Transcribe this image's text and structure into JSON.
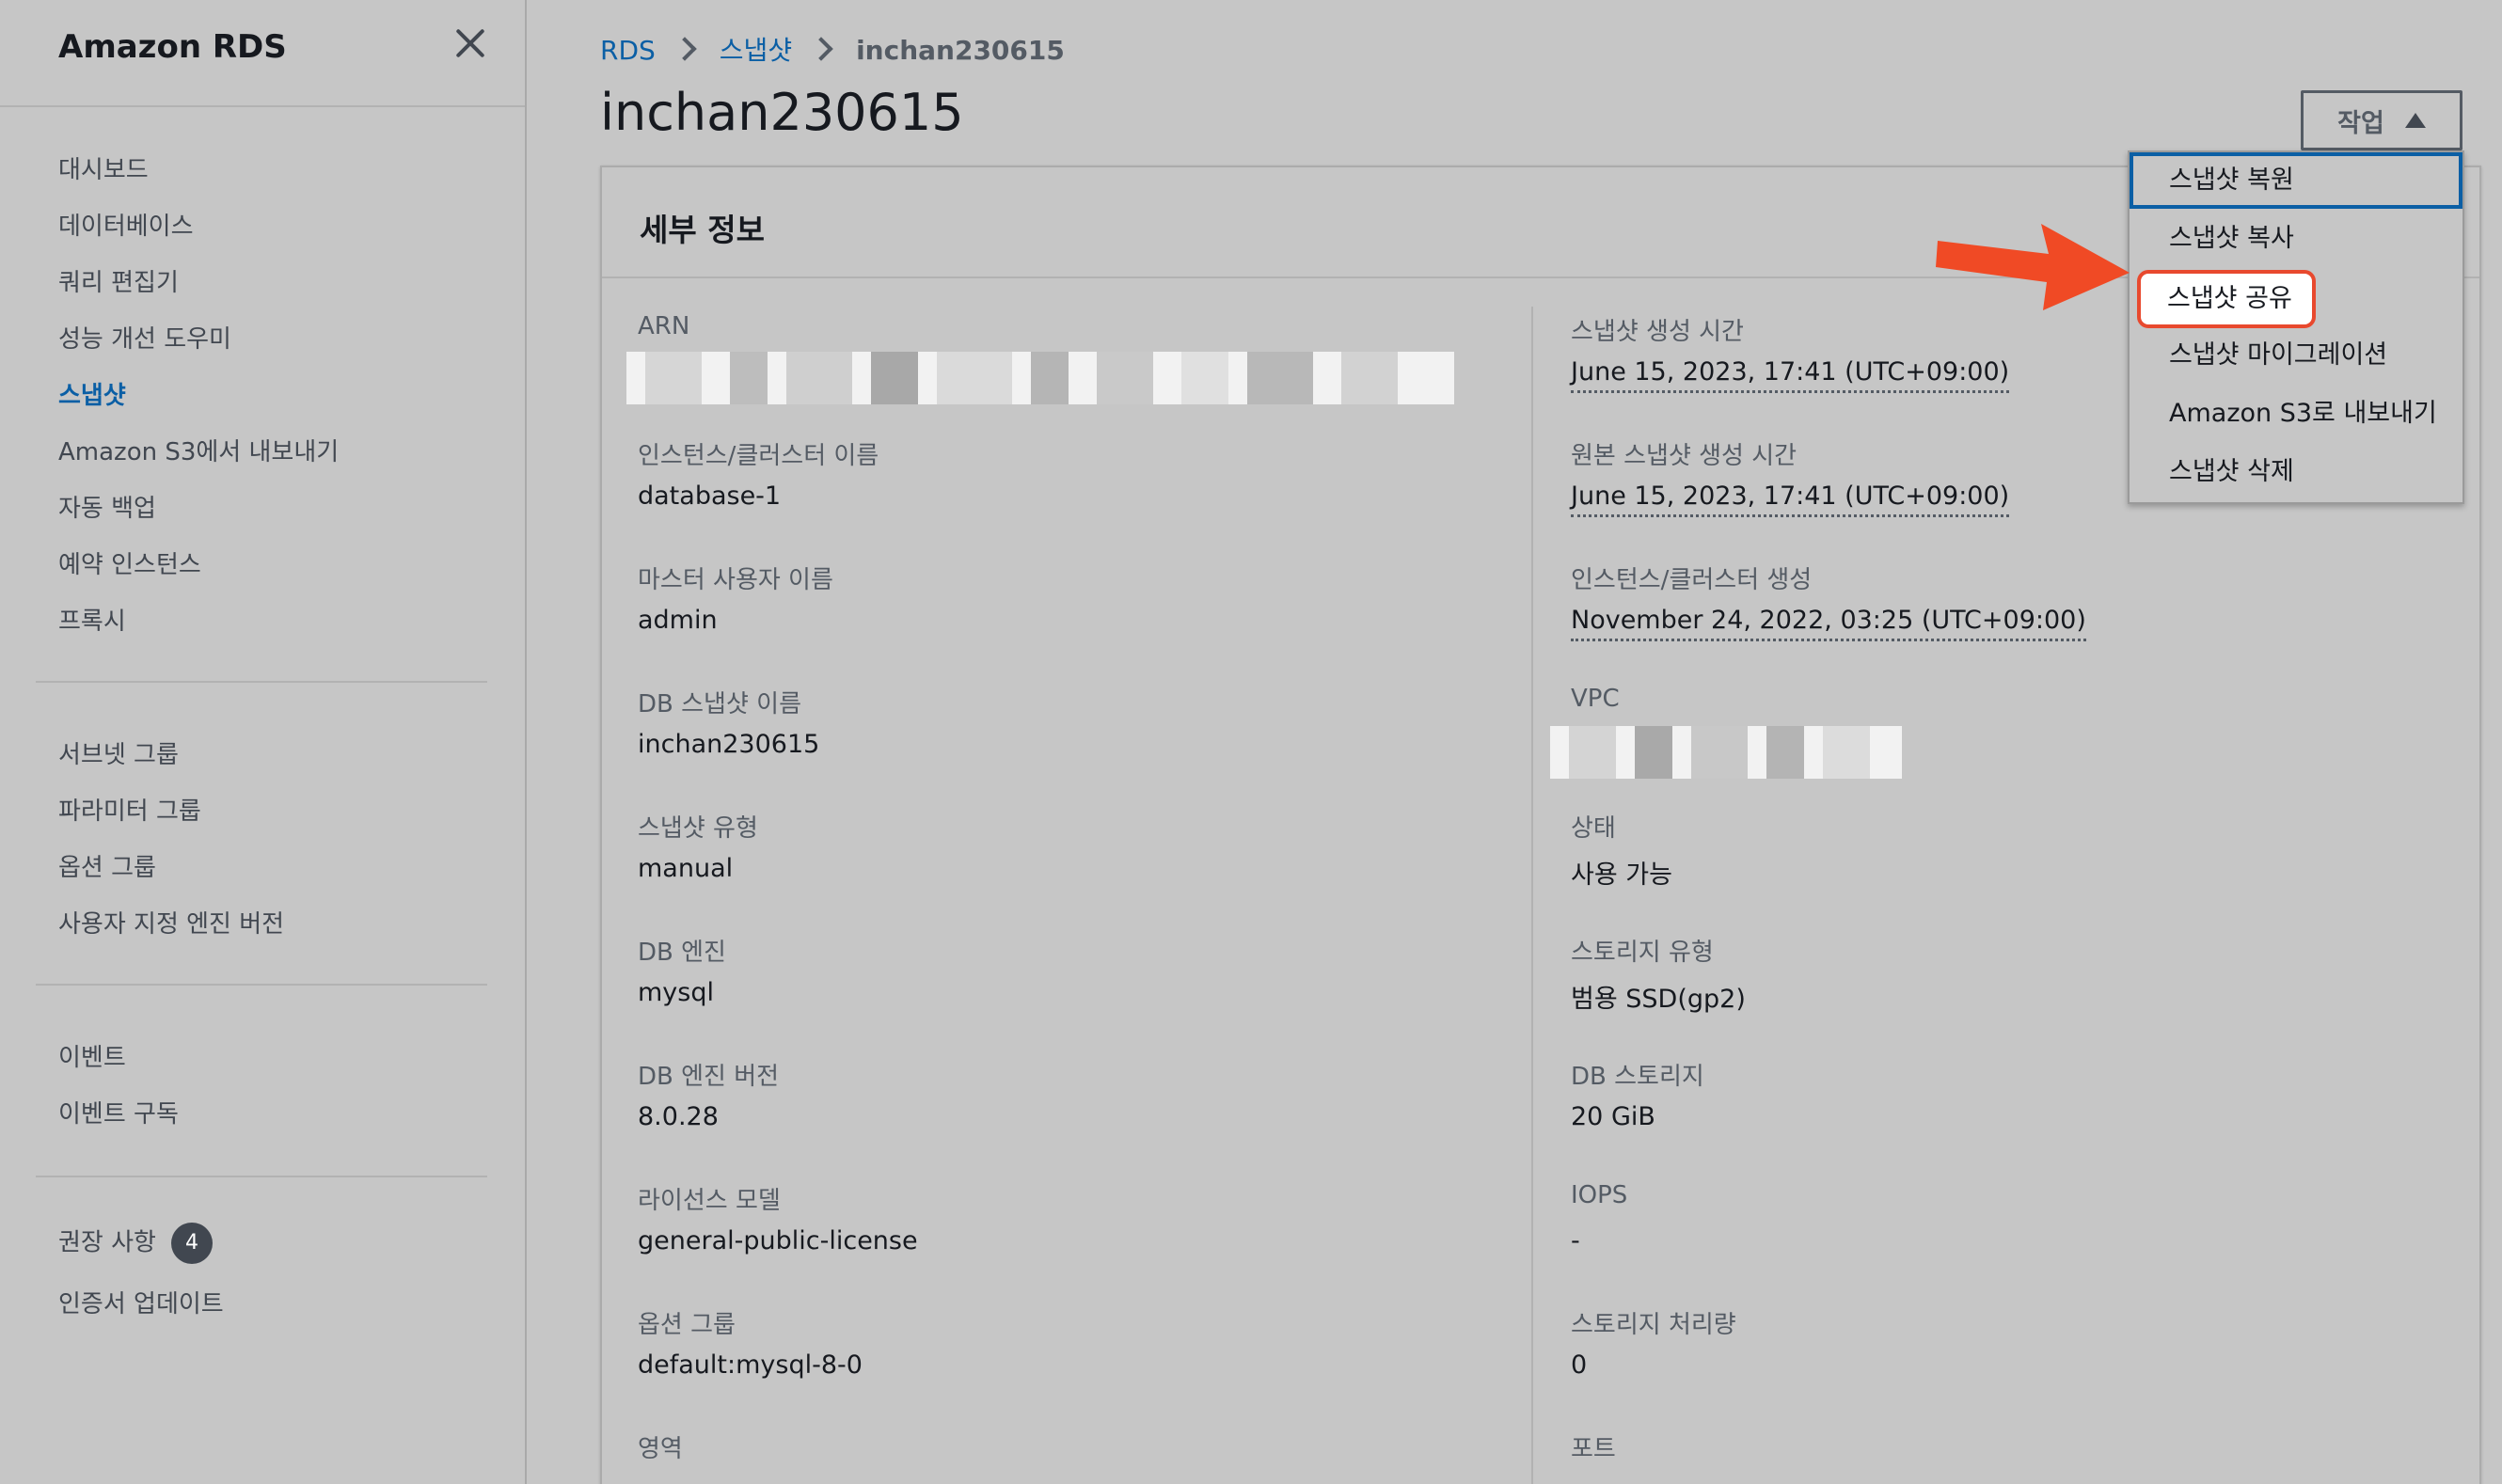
{
  "sidebar": {
    "title": "Amazon RDS",
    "groups": [
      [
        "대시보드",
        "데이터베이스",
        "쿼리 편집기",
        "성능 개선 도우미",
        "스냅샷",
        "Amazon S3에서 내보내기",
        "자동 백업",
        "예약 인스턴스",
        "프록시"
      ],
      [
        "서브넷 그룹",
        "파라미터 그룹",
        "옵션 그룹",
        "사용자 지정 엔진 버전"
      ],
      [
        "이벤트",
        "이벤트 구독"
      ],
      [
        "권장 사항",
        "인증서 업데이트"
      ]
    ],
    "active_item": "스냅샷",
    "recommendations_badge": "4"
  },
  "breadcrumb": {
    "root": "RDS",
    "section": "스냅샷",
    "current": "inchan230615"
  },
  "page_title": "inchan230615",
  "actions_label": "작업",
  "details": {
    "title": "세부 정보",
    "left": [
      {
        "label": "ARN",
        "value": ""
      },
      {
        "label": "인스턴스/클러스터 이름",
        "value": "database-1"
      },
      {
        "label": "마스터 사용자 이름",
        "value": "admin"
      },
      {
        "label": "DB 스냅샷 이름",
        "value": "inchan230615"
      },
      {
        "label": "스냅샷 유형",
        "value": "manual"
      },
      {
        "label": "DB 엔진",
        "value": "mysql"
      },
      {
        "label": "DB 엔진 버전",
        "value": "8.0.28"
      },
      {
        "label": "라이선스 모델",
        "value": "general-public-license"
      },
      {
        "label": "옵션 그룹",
        "value": "default:mysql-8-0"
      },
      {
        "label": "영역",
        "value": ""
      }
    ],
    "right": [
      {
        "label": "스냅샷 생성 시간",
        "value": "June 15, 2023, 17:41 (UTC+09:00)"
      },
      {
        "label": "원본 스냅샷 생성 시간",
        "value": "June 15, 2023, 17:41 (UTC+09:00)"
      },
      {
        "label": "인스턴스/클러스터 생성",
        "value": "November 24, 2022, 03:25 (UTC+09:00)"
      },
      {
        "label": "VPC",
        "value": ""
      },
      {
        "label": "상태",
        "value": "사용 가능"
      },
      {
        "label": "스토리지 유형",
        "value": "범용 SSD(gp2)"
      },
      {
        "label": "DB 스토리지",
        "value": "20 GiB"
      },
      {
        "label": "IOPS",
        "value": "-"
      },
      {
        "label": "스토리지 처리량",
        "value": "0"
      },
      {
        "label": "포트",
        "value": ""
      }
    ]
  },
  "dropdown": {
    "items": [
      "스냅샷 복원",
      "스냅샷 복사",
      "스냅샷 공유",
      "스냅샷 마이그레이션",
      "Amazon S3로 내보내기",
      "스냅샷 삭제"
    ],
    "focused_item": "스냅샷 복원",
    "highlighted_item": "스냅샷 공유"
  },
  "colors": {
    "accent_link": "#0b5fa5",
    "highlight": "#e8492e",
    "arrow": "#f04a25"
  }
}
